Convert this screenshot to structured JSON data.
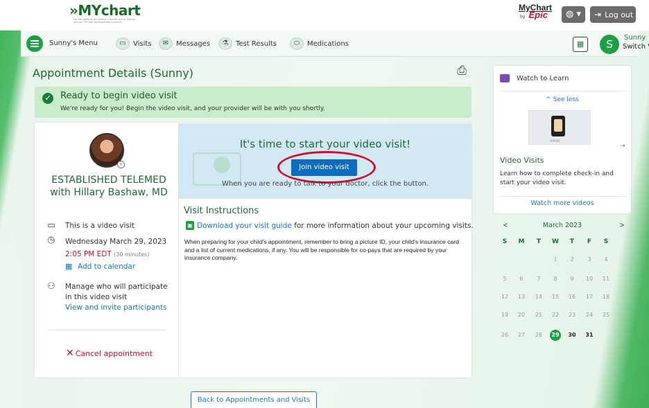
{
  "header": {
    "brand_main": "MYchart",
    "brand_chevron": "»",
    "brand_tagline": "For the patients of Children's Healthcare of Atlanta and our MYchart participating practices",
    "epic_mychart": "MyChart",
    "epic_by": "by",
    "epic_epic": "Epic",
    "logout_label": "Log out",
    "globe_icon": "globe-icon"
  },
  "nav": {
    "menu_label": "Sunny's Menu",
    "items": [
      {
        "label": "Visits",
        "icon": "calendar-icon"
      },
      {
        "label": "Messages",
        "icon": "envelope-icon"
      },
      {
        "label": "Test Results",
        "icon": "flask-icon"
      },
      {
        "label": "Medications",
        "icon": "pill-icon"
      }
    ],
    "user": {
      "initial": "S",
      "name": "Sunny",
      "switch_label": "Switch"
    }
  },
  "page": {
    "title": "Appointment Details (Sunny)",
    "alert": {
      "title": "Ready to begin video visit",
      "body": "We're ready for you! Begin the video visit, and your provider will be with you shortly."
    },
    "appointment": {
      "visit_type": "ESTABLISHED TELEMED with Hillary Bashaw, MD",
      "video_note": "This is a video visit",
      "date": "Wednesday March 29, 2023",
      "time": "2:05 PM EDT",
      "duration": "(30 minutes)",
      "add_calendar": "Add to calendar",
      "manage_participants": "Manage who will participate",
      "manage_participants_2": "in this video visit",
      "invite_link": "View and invite participants",
      "cancel_label": "Cancel appointment"
    },
    "video": {
      "title": "It's time to start your video visit!",
      "join_button": "Join video visit",
      "subtext": "When you are ready to talk to your doctor, click the button."
    },
    "instructions": {
      "title": "Visit Instructions",
      "guide_link": "Download your visit guide",
      "guide_tail": " for more information about your upcoming visits.",
      "body": "When preparing for your child's appointment,  remember to bring a picture ID, your child's insurance card and a list of current medications, if any. You will be responsible for co-pays that are required by your insurance company."
    },
    "back_button": "Back to Appointments and Visits"
  },
  "learn": {
    "title": "Watch to Learn",
    "see_less": "See less",
    "video_title": "Video Visits",
    "video_body": "Learn how to complete check-in and start your video visit.",
    "watch_more": "Watch more videos"
  },
  "calendar": {
    "month": "March 2023",
    "prev": "<",
    "next": ">",
    "dow": [
      "S",
      "M",
      "T",
      "W",
      "T",
      "F",
      "S"
    ],
    "weeks": [
      [
        "",
        "",
        "",
        "1",
        "2",
        "3",
        "4"
      ],
      [
        "5",
        "6",
        "7",
        "8",
        "9",
        "10",
        "11"
      ],
      [
        "12",
        "13",
        "14",
        "15",
        "16",
        "17",
        "18"
      ],
      [
        "19",
        "20",
        "21",
        "22",
        "23",
        "24",
        "25"
      ],
      [
        "26",
        "27",
        "28",
        "29",
        "30",
        "31",
        ""
      ]
    ],
    "selected_day": "29"
  },
  "colors": {
    "brand_green": "#1d6b33",
    "accent_green": "#1f9e45",
    "alert_bg": "#c8ecc9",
    "link_blue": "#1976c9",
    "button_blue": "#0f6cbd",
    "cancel_red": "#c8102e",
    "annotation_red": "#d0102a"
  }
}
